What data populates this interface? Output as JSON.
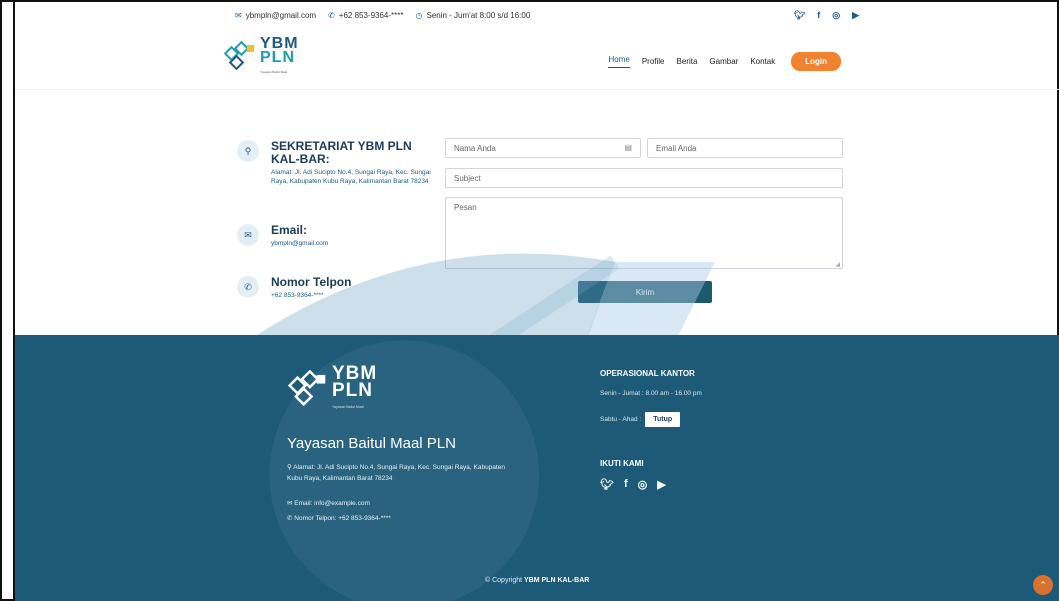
{
  "topbar": {
    "email": "ybmpln@gmail.com",
    "phone": "+62 853-9364-****",
    "hours": "Senin - Jum'at 8:00 s/d 16:00",
    "social": [
      "twitter-icon",
      "facebook-icon",
      "instagram-icon",
      "youtube-icon"
    ]
  },
  "header": {
    "logo_line1": "YBM",
    "logo_line2": "PLN",
    "logo_sub": "Yayasan Baitul Maal",
    "nav": [
      "Home",
      "Profile",
      "Berita",
      "Gambar",
      "Kontak"
    ],
    "login_label": "Login"
  },
  "contact": {
    "office_title": "SEKRETARIAT YBM PLN KAL-BAR:",
    "office_address": "Alamat: Jl. Adi Sucipto No.4, Sungai Raya, Kec. Sungai Raya, Kabupaten Kubu Raya, Kalimantan Barat 78234",
    "email_title": "Email:",
    "email_value": "ybmpln@gmail.com",
    "phone_title": "Nomor Telpon",
    "phone_value": "+62 853-9364-****"
  },
  "form": {
    "name_placeholder": "Nama Anda",
    "email_placeholder": "Email Anda",
    "subject_placeholder": "Subject",
    "message_placeholder": "Pesan",
    "send_label": "Kirim"
  },
  "footer": {
    "logo_line1": "YBM",
    "logo_line2": "PLN",
    "logo_sub": "Yayasan Baitul Maal",
    "org_name": "Yayasan Baitul Maal PLN",
    "address": "Alamat: Jl. Adi Sucipto No.4, Sungai Raya, Kec. Sungai Raya, Kabupaten Kubu Raya, Kalimantan Barat 78234",
    "email": "Email: info@example.com",
    "phone": "Nomor Telpon: +62 853-9364-****",
    "ops_title": "OPERASIONAL KANTOR",
    "ops_weekday": "Senin - Jumat : 8.00 am - 16.00 pm",
    "ops_weekend_label": "Sabtu - Ahad :",
    "ops_weekend_value": "Tutup",
    "follow_title": "IKUTI KAMI",
    "copyright_prefix": "© Copyright ",
    "copyright_name": "YBM PLN KAL-BAR"
  },
  "colors": {
    "primary": "#1d5a87",
    "accent": "#f0832f",
    "footer_bg": "#1d5a78"
  }
}
